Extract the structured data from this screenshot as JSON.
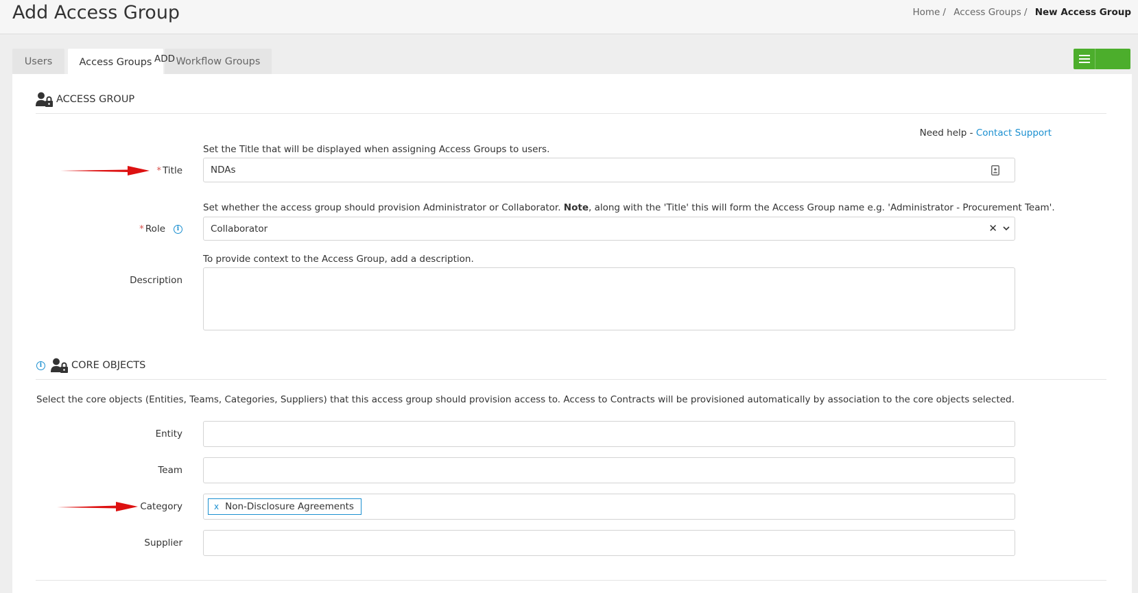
{
  "header": {
    "title": "Add Access Group",
    "breadcrumb": [
      "Home",
      "Access Groups",
      "New Access Group"
    ]
  },
  "tabs": [
    {
      "label": "Users"
    },
    {
      "label": "Access Groups"
    },
    {
      "label": "Workflow Groups"
    }
  ],
  "toolbar": {
    "add_label": "ADD"
  },
  "access_group": {
    "heading": "ACCESS GROUP",
    "help_text": "Need help - ",
    "help_link": "Contact Support",
    "title_hint": "Set the Title that will be displayed when assigning Access Groups to users.",
    "title_label": "Title",
    "title_value": "NDAs",
    "role_hint_pre": "Set whether the access group should provision Administrator or Collaborator. ",
    "role_hint_bold": "Note",
    "role_hint_post": ", along with the 'Title' this will form the Access Group name e.g. 'Administrator - Procurement Team'.",
    "role_label": "Role",
    "role_value": "Collaborator",
    "description_hint": "To provide context to the Access Group, add a description.",
    "description_label": "Description",
    "description_value": ""
  },
  "core_objects": {
    "heading": "CORE OBJECTS",
    "intro": "Select the core objects (Entities, Teams, Categories, Suppliers) that this access group should provision access to. Access to Contracts will be provisioned automatically by association to the core objects selected.",
    "entity_label": "Entity",
    "team_label": "Team",
    "category_label": "Category",
    "category_tags": [
      "Non-Disclosure Agreements"
    ],
    "supplier_label": "Supplier"
  },
  "colors": {
    "accent": "#1a8fd0",
    "add_button": "#4cae2c",
    "required": "#d9534f",
    "annotation_arrow": "#dd1111"
  }
}
